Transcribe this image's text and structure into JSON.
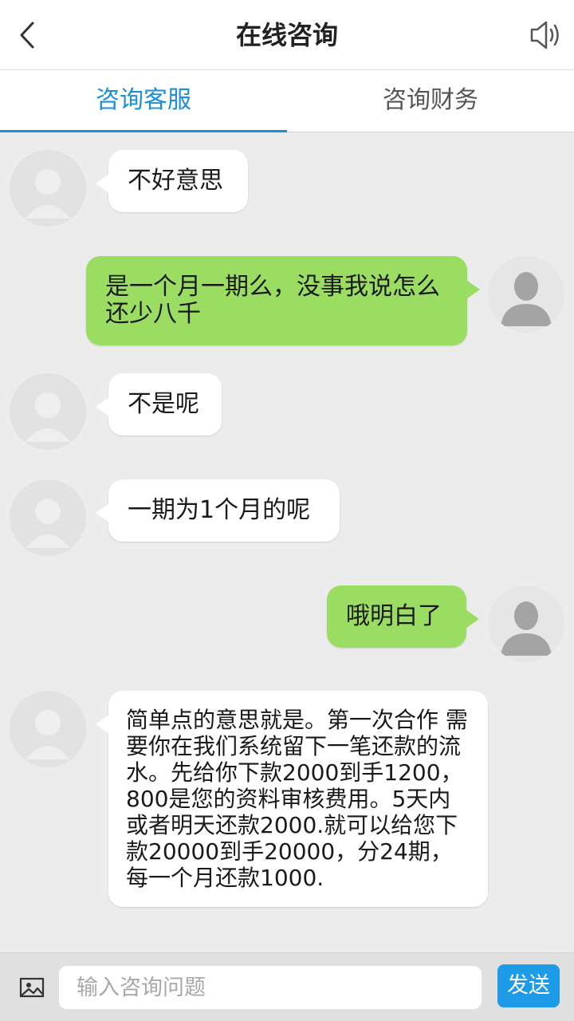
{
  "header": {
    "title": "在线咨询",
    "back_icon": "chevron-left-icon",
    "speaker_icon": "speaker-icon"
  },
  "tabs": [
    {
      "label": "咨询客服",
      "active": true
    },
    {
      "label": "咨询财务",
      "active": false
    }
  ],
  "messages": [
    {
      "side": "left",
      "text": "不好意思"
    },
    {
      "side": "right",
      "text": "是一个月一期么，没事我说怎么还少八千"
    },
    {
      "side": "left",
      "text": "不是呢"
    },
    {
      "side": "left",
      "text": "一期为1个月的呢"
    },
    {
      "side": "right",
      "text": "哦明白了"
    },
    {
      "side": "left",
      "text": "简单点的意思就是。第一次合作 需要你在我们系统留下一笔还款的流水。先给你下款2000到手1200，800是您的资料审核费用。5天内或者明天还款2000.就可以给您下款20000到手20000，分24期，每一个月还款1000."
    }
  ],
  "footer": {
    "image_icon": "image-icon",
    "input_placeholder": "输入咨询问题",
    "input_value": "",
    "send_label": "发送"
  },
  "colors": {
    "accent": "#1b8fd8",
    "outgoing_bubble": "#9bdd62",
    "incoming_bubble": "#ffffff",
    "chat_background": "#ececec"
  }
}
